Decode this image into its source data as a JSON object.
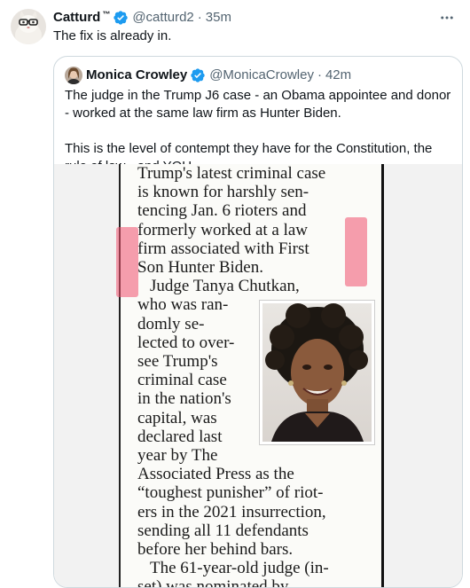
{
  "tweet": {
    "author_name": "Catturd",
    "author_tm": "™",
    "handle": "@catturd2",
    "separator": "·",
    "time": "35m",
    "text": "The fix is already in."
  },
  "quote": {
    "author_name": "Monica Crowley",
    "handle": "@MonicaCrowley",
    "separator": "·",
    "time": "42m",
    "paragraph1": "The judge in the Trump J6 case - an Obama appointee and donor - worked at the same law firm as Hunter Biden.",
    "paragraph2": "This is the level of contempt they have for the Constitution, the rule of law - and YOU."
  },
  "clipping": {
    "lines_full": [
      "Trump's latest criminal case",
      "is known for harshly sen-",
      "tencing Jan. 6 rioters and",
      "formerly worked at a law",
      "firm associated with First",
      "Son Hunter Biden."
    ],
    "judge_line": "Judge Tanya Chutkan,",
    "lines_narrow": [
      "who was ran-",
      "domly se-",
      "lected to over-",
      "see Trump's",
      "criminal case",
      "in the nation's",
      "capital, was",
      "declared last",
      "year by The"
    ],
    "lines_bottom": [
      "Associated Press as the",
      "“toughest punisher” of riot-",
      "ers in the 2021 insurrection,",
      "sending all 11 defendants",
      "before her behind bars."
    ],
    "last_line": "The 61-year-old judge (in-",
    "cut_line": "set) was nominated by"
  },
  "colors": {
    "verified": "#1d9bf0",
    "secondary_text": "#536471",
    "highlight": "#f0506e"
  },
  "icons": {
    "verified": "verified-badge-icon",
    "more": "more-options-icon"
  }
}
